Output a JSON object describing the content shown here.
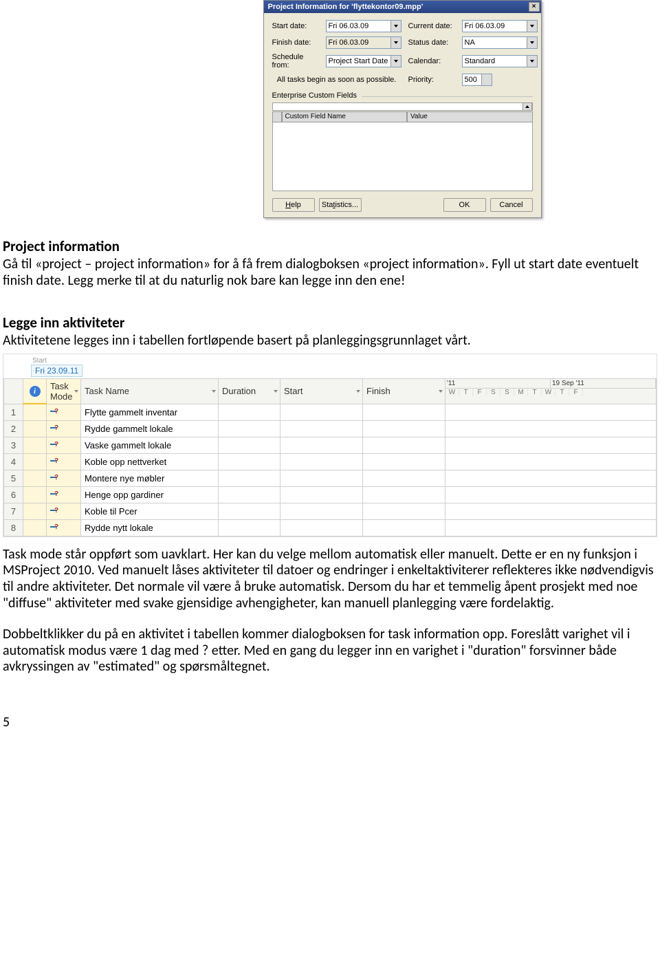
{
  "dialog": {
    "title": "Project Information for 'flyttekontor09.mpp'",
    "labels": {
      "start_date": "Start date:",
      "finish_date": "Finish date:",
      "schedule_from": "Schedule from:",
      "current_date": "Current date:",
      "status_date": "Status date:",
      "calendar": "Calendar:",
      "priority": "Priority:",
      "note": "All tasks begin as soon as possible.",
      "ecf": "Enterprise Custom Fields",
      "cf_name": "Custom Field Name",
      "cf_value": "Value"
    },
    "values": {
      "start_date": "Fri 06.03.09",
      "finish_date": "Fri 06.03.09",
      "schedule_from": "Project Start Date",
      "current_date": "Fri 06.03.09",
      "status_date": "NA",
      "calendar": "Standard",
      "priority": "500"
    },
    "buttons": {
      "help": "Help",
      "statistics": "Statistics...",
      "ok": "OK",
      "cancel": "Cancel"
    }
  },
  "doc": {
    "h1": "Project information",
    "p1": "Gå til «project – project information» for å få frem dialogboksen «project information». Fyll ut start date eventuelt finish date. Legg merke til at du naturlig nok bare kan legge inn den ene!",
    "h2": "Legge inn aktiviteter",
    "p2": "Aktivitetene legges inn i tabellen fortløpende basert på planleggingsgrunnlaget vårt.",
    "p3": "Task mode står oppført som uavklart. Her kan du velge mellom automatisk eller manuelt. Dette er en ny funksjon i MSProject 2010. Ved manuelt låses aktiviteter til datoer og endringer i enkeltaktiviterer reflekteres ikke nødvendigvis til andre aktiviteter. Det normale vil være å bruke automatisk. Dersom du har et temmelig åpent prosjekt med noe \"diffuse\" aktiviteter med svake gjensidige avhengigheter, kan manuell planlegging være fordelaktig.",
    "p4": "Dobbeltklikker du på en aktivitet i tabellen kommer dialogboksen for task information opp. Foreslått varighet vil i automatisk modus være 1 dag med ? etter. Med en gang du legger inn en varighet i \"duration\" forsvinner både avkryssingen av \"estimated\" og spørsmåltegnet."
  },
  "gantt": {
    "start_label": "Start",
    "start_date": "Fri 23.09.11",
    "cols": {
      "task_mode": "Task Mode",
      "task_name": "Task Name",
      "duration": "Duration",
      "start": "Start",
      "finish": "Finish"
    },
    "timeline": {
      "groups": [
        "'11",
        "19 Sep '11"
      ],
      "days": [
        "W",
        "T",
        "F",
        "S",
        "S",
        "M",
        "T",
        "W",
        "T",
        "F"
      ]
    },
    "rows": [
      {
        "n": "1",
        "name": "Flytte gammelt inventar"
      },
      {
        "n": "2",
        "name": "Rydde gammelt lokale"
      },
      {
        "n": "3",
        "name": "Vaske gammelt lokale"
      },
      {
        "n": "4",
        "name": "Koble opp nettverket"
      },
      {
        "n": "5",
        "name": "Montere nye møbler"
      },
      {
        "n": "6",
        "name": "Henge opp gardiner"
      },
      {
        "n": "7",
        "name": "Koble til Pcer"
      },
      {
        "n": "8",
        "name": "Rydde nytt lokale"
      }
    ]
  },
  "page_number": "5"
}
